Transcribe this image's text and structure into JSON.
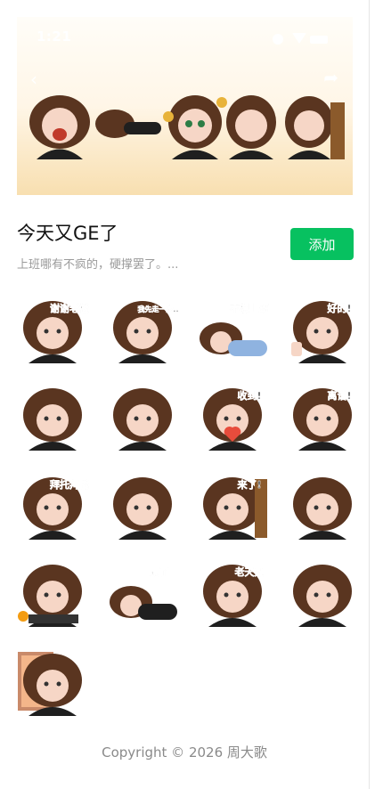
{
  "status_bar": {
    "time": "1:21"
  },
  "pack": {
    "title": "今天又GE了",
    "subtitle": "上班哪有不疯的，硬撑罢了。...",
    "add_label": "添加"
  },
  "colors": {
    "accent": "#07c160",
    "hair": "#5a3520",
    "skin": "#f6d6c6",
    "shirt": "#1f1f1f"
  },
  "stickers": [
    {
      "caption": "谢谢老板",
      "icon": "money-eyes"
    },
    {
      "caption": "我先走一步...",
      "icon": "fainted-ghost"
    },
    {
      "caption": "不想上班",
      "icon": "sleeping"
    },
    {
      "caption": "好的!",
      "icon": "thumbs-up"
    },
    {
      "caption": "",
      "icon": "smug-arms-crossed"
    },
    {
      "caption": "",
      "icon": "speechless"
    },
    {
      "caption": "收到!",
      "icon": "heart"
    },
    {
      "caption": "离谱!",
      "icon": "annoyed"
    },
    {
      "caption": "拜托拜托",
      "icon": "praying"
    },
    {
      "caption": "",
      "icon": "crying-crouch"
    },
    {
      "caption": "来了!",
      "icon": "door-peek"
    },
    {
      "caption": "",
      "icon": "laugh-cry"
    },
    {
      "caption": "",
      "icon": "angry-keyboard"
    },
    {
      "caption": "累了",
      "icon": "lying-down"
    },
    {
      "caption": "老天奶",
      "icon": "screaming"
    },
    {
      "caption": "",
      "icon": "sweating"
    },
    {
      "caption": "",
      "icon": "window-sad"
    }
  ],
  "footer": {
    "copyright": "Copyright © 2026 周大歌"
  }
}
